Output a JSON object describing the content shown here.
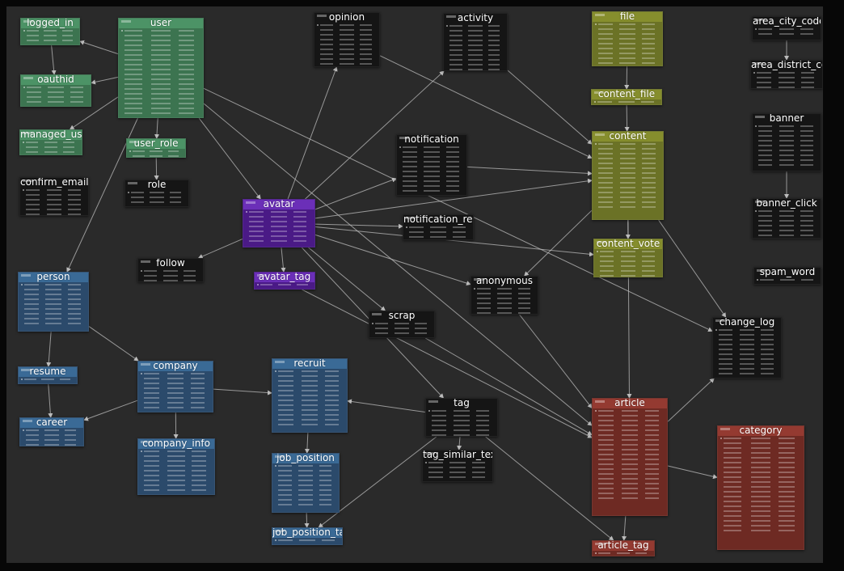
{
  "colors": {
    "green": "#4c9366",
    "black": "#151515",
    "purple": "#6b2fb8",
    "blue": "#3a6a96",
    "olive": "#868e2d",
    "red": "#943a31",
    "line": "#bdbdbd",
    "canvas": "#2a2a2a"
  },
  "tables": [
    {
      "id": "logged_in",
      "name": "logged_in",
      "color": "green"
    },
    {
      "id": "user",
      "name": "user",
      "color": "green"
    },
    {
      "id": "oauthid",
      "name": "oauthid",
      "color": "green"
    },
    {
      "id": "managed_user",
      "name": "managed_user",
      "color": "green"
    },
    {
      "id": "user_role",
      "name": "user_role",
      "color": "green"
    },
    {
      "id": "confirm_email",
      "name": "confirm_email",
      "color": "black"
    },
    {
      "id": "role",
      "name": "role",
      "color": "black"
    },
    {
      "id": "opinion",
      "name": "opinion",
      "color": "black"
    },
    {
      "id": "activity",
      "name": "activity",
      "color": "black"
    },
    {
      "id": "file",
      "name": "file",
      "color": "olive"
    },
    {
      "id": "content_file",
      "name": "content_file",
      "color": "olive"
    },
    {
      "id": "content",
      "name": "content",
      "color": "olive"
    },
    {
      "id": "content_vote",
      "name": "content_vote",
      "color": "olive"
    },
    {
      "id": "area_city_code",
      "name": "area_city_code",
      "color": "black"
    },
    {
      "id": "area_district_code",
      "name": "area_district_code",
      "color": "black"
    },
    {
      "id": "banner",
      "name": "banner",
      "color": "black"
    },
    {
      "id": "banner_click",
      "name": "banner_click",
      "color": "black"
    },
    {
      "id": "spam_word",
      "name": "spam_word",
      "color": "black"
    },
    {
      "id": "notification",
      "name": "notification",
      "color": "black"
    },
    {
      "id": "notification_read",
      "name": "notification_read",
      "color": "black"
    },
    {
      "id": "avatar",
      "name": "avatar",
      "color": "purple"
    },
    {
      "id": "avatar_tag",
      "name": "avatar_tag",
      "color": "purple"
    },
    {
      "id": "follow",
      "name": "follow",
      "color": "black"
    },
    {
      "id": "anonymous",
      "name": "anonymous",
      "color": "black"
    },
    {
      "id": "scrap",
      "name": "scrap",
      "color": "black"
    },
    {
      "id": "change_log",
      "name": "change_log",
      "color": "black"
    },
    {
      "id": "person",
      "name": "person",
      "color": "blue"
    },
    {
      "id": "resume",
      "name": "resume",
      "color": "blue"
    },
    {
      "id": "career",
      "name": "career",
      "color": "blue"
    },
    {
      "id": "company",
      "name": "company",
      "color": "blue"
    },
    {
      "id": "company_info",
      "name": "company_info",
      "color": "blue"
    },
    {
      "id": "recruit",
      "name": "recruit",
      "color": "blue"
    },
    {
      "id": "job_position",
      "name": "job_position",
      "color": "blue"
    },
    {
      "id": "job_position_tag",
      "name": "job_position_tag",
      "color": "blue"
    },
    {
      "id": "tag",
      "name": "tag",
      "color": "black"
    },
    {
      "id": "tag_similar_text",
      "name": "tag_similar_text",
      "color": "black"
    },
    {
      "id": "article",
      "name": "article",
      "color": "red"
    },
    {
      "id": "article_tag",
      "name": "article_tag",
      "color": "red"
    },
    {
      "id": "category",
      "name": "category",
      "color": "red"
    }
  ],
  "relations": [
    {
      "from": "logged_in",
      "to": "oauthid"
    },
    {
      "from": "user",
      "to": "logged_in"
    },
    {
      "from": "user",
      "to": "oauthid"
    },
    {
      "from": "user",
      "to": "managed_user"
    },
    {
      "from": "user",
      "to": "user_role"
    },
    {
      "from": "user_role",
      "to": "role"
    },
    {
      "from": "user",
      "to": "person"
    },
    {
      "from": "user",
      "to": "avatar"
    },
    {
      "from": "user",
      "to": "article"
    },
    {
      "from": "user",
      "to": "change_log"
    },
    {
      "from": "avatar",
      "to": "opinion"
    },
    {
      "from": "avatar",
      "to": "activity"
    },
    {
      "from": "avatar",
      "to": "notification"
    },
    {
      "from": "avatar",
      "to": "notification_read"
    },
    {
      "from": "avatar",
      "to": "content"
    },
    {
      "from": "avatar",
      "to": "content_vote"
    },
    {
      "from": "avatar",
      "to": "follow"
    },
    {
      "from": "avatar",
      "to": "avatar_tag"
    },
    {
      "from": "avatar",
      "to": "scrap"
    },
    {
      "from": "avatar",
      "to": "anonymous"
    },
    {
      "from": "avatar",
      "to": "tag"
    },
    {
      "from": "opinion",
      "to": "content"
    },
    {
      "from": "activity",
      "to": "content"
    },
    {
      "from": "notification",
      "to": "content"
    },
    {
      "from": "file",
      "to": "content_file"
    },
    {
      "from": "content_file",
      "to": "content"
    },
    {
      "from": "content",
      "to": "content_vote"
    },
    {
      "from": "content",
      "to": "anonymous"
    },
    {
      "from": "content",
      "to": "change_log"
    },
    {
      "from": "content",
      "to": "article"
    },
    {
      "from": "area_city_code",
      "to": "area_district_code"
    },
    {
      "from": "banner",
      "to": "banner_click"
    },
    {
      "from": "person",
      "to": "resume"
    },
    {
      "from": "person",
      "to": "company"
    },
    {
      "from": "resume",
      "to": "career"
    },
    {
      "from": "company",
      "to": "career"
    },
    {
      "from": "company",
      "to": "company_info"
    },
    {
      "from": "company",
      "to": "recruit"
    },
    {
      "from": "recruit",
      "to": "job_position"
    },
    {
      "from": "job_position",
      "to": "job_position_tag"
    },
    {
      "from": "tag",
      "to": "job_position_tag"
    },
    {
      "from": "tag",
      "to": "tag_similar_text"
    },
    {
      "from": "tag",
      "to": "article_tag"
    },
    {
      "from": "tag",
      "to": "recruit"
    },
    {
      "from": "scrap",
      "to": "article"
    },
    {
      "from": "anonymous",
      "to": "article"
    },
    {
      "from": "article",
      "to": "article_tag"
    },
    {
      "from": "article",
      "to": "category"
    },
    {
      "from": "article",
      "to": "change_log"
    },
    {
      "from": "avatar_tag",
      "to": "article"
    }
  ]
}
